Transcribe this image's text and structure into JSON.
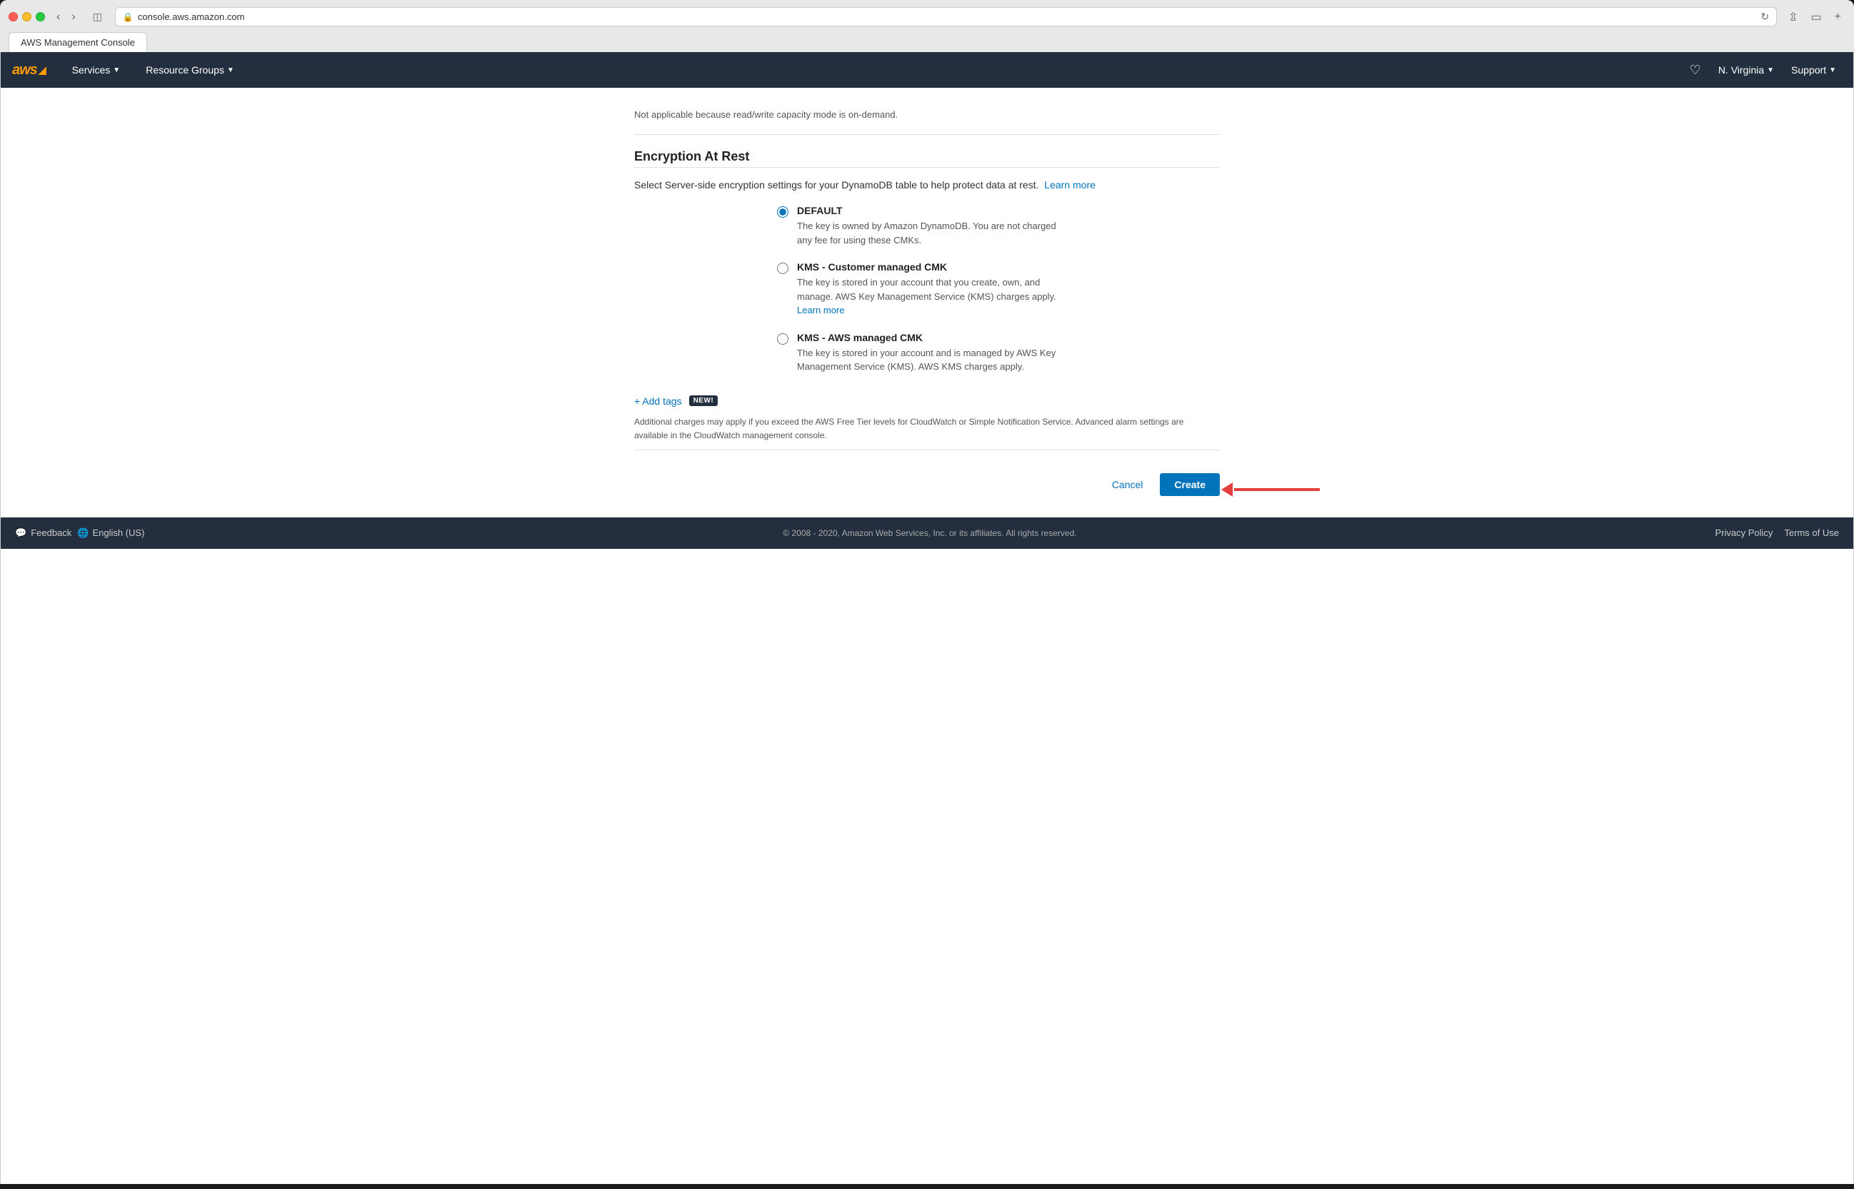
{
  "browser": {
    "url": "console.aws.amazon.com",
    "tab_label": "AWS Management Console"
  },
  "nav": {
    "logo_text": "aws",
    "services_label": "Services",
    "resource_groups_label": "Resource Groups",
    "region_label": "N. Virginia",
    "support_label": "Support"
  },
  "page": {
    "not_applicable_text": "Not applicable because read/write capacity mode is on-demand.",
    "section_title": "Encryption At Rest",
    "section_description": "Select Server-side encryption settings for your DynamoDB table to help protect data at rest.",
    "learn_more_label": "Learn more",
    "radio_options": [
      {
        "id": "default",
        "label": "DEFAULT",
        "description": "The key is owned by Amazon DynamoDB. You are not charged any fee for using these CMKs.",
        "checked": true,
        "learn_more": false
      },
      {
        "id": "kms-customer",
        "label": "KMS - Customer managed CMK",
        "description": "The key is stored in your account that you create, own, and manage. AWS Key Management Service (KMS) charges apply.",
        "learn_more_label": "Learn more",
        "checked": false
      },
      {
        "id": "kms-aws",
        "label": "KMS - AWS managed CMK",
        "description": "The key is stored in your account and is managed by AWS Key Management Service (KMS). AWS KMS charges apply.",
        "checked": false
      }
    ],
    "add_tags_label": "+ Add tags",
    "new_badge_label": "NEW!",
    "charges_notice": "Additional charges may apply if you exceed the AWS Free Tier levels for CloudWatch or Simple Notification Service. Advanced alarm settings are available in the CloudWatch management console.",
    "cancel_label": "Cancel",
    "create_label": "Create"
  },
  "footer": {
    "feedback_label": "Feedback",
    "language_label": "English (US)",
    "copyright_text": "© 2008 - 2020, Amazon Web Services, Inc. or its affiliates. All rights reserved.",
    "privacy_policy_label": "Privacy Policy",
    "terms_of_use_label": "Terms of Use"
  }
}
